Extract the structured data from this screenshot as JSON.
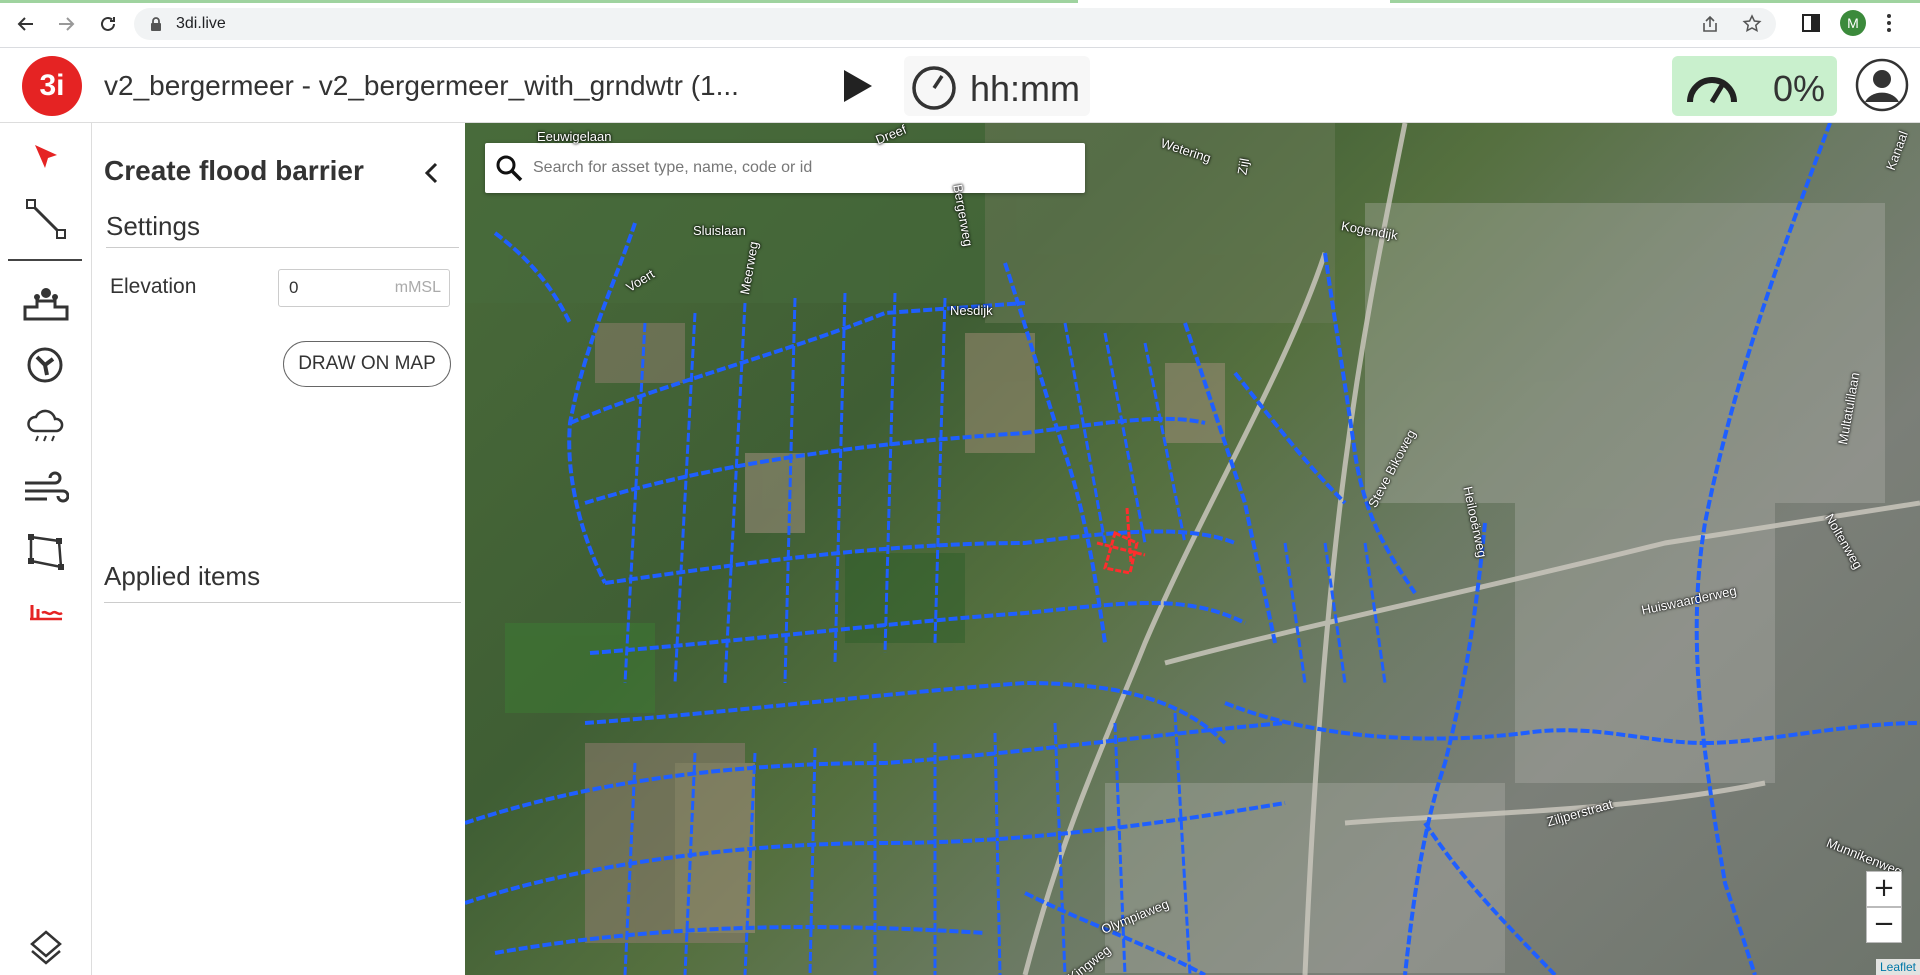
{
  "browser": {
    "url": "3di.live",
    "profile_initial": "M",
    "icons": [
      "back-icon",
      "forward-icon",
      "reload-icon",
      "lock-icon",
      "share-icon",
      "star-icon",
      "side-panel-icon",
      "menu-icon"
    ]
  },
  "header": {
    "logo_text": "3i",
    "model_title": "v2_bergermeer - v2_bergermeer_with_grndwtr (1...",
    "time": "hh:mm",
    "speed_percent": "0%"
  },
  "tools": [
    "select-tool",
    "line-tool",
    "discharge-tool",
    "pump-tool",
    "rain-tool",
    "wind-tool",
    "polygon-tool",
    "flood-barrier-tool",
    "layers-tool"
  ],
  "panel": {
    "title": "Create flood barrier",
    "settings_title": "Settings",
    "elevation_label": "Elevation",
    "elevation_value": "0",
    "elevation_unit": "mMSL",
    "draw_button": "DRAW ON MAP",
    "applied_title": "Applied items"
  },
  "map": {
    "search_placeholder": "Search for asset type, name, code or id",
    "zoom_in": "+",
    "zoom_out": "−",
    "attribution": "Leaflet",
    "places": [
      "Eeuwigelaan",
      "Sluislaan",
      "Voert",
      "Meerweg",
      "Bergerweg",
      "Nesdijk",
      "Wetering",
      "Zijl",
      "Kogendijk",
      "Steve Bikoweg",
      "Heilooërweg",
      "Huiswaarderweg",
      "Noltenweg",
      "Multatulilaan",
      "Ziljperstraat",
      "Olympiaweg",
      "Munnikenweg",
      "Kingweg",
      "Dreef",
      "Kanaal"
    ]
  }
}
